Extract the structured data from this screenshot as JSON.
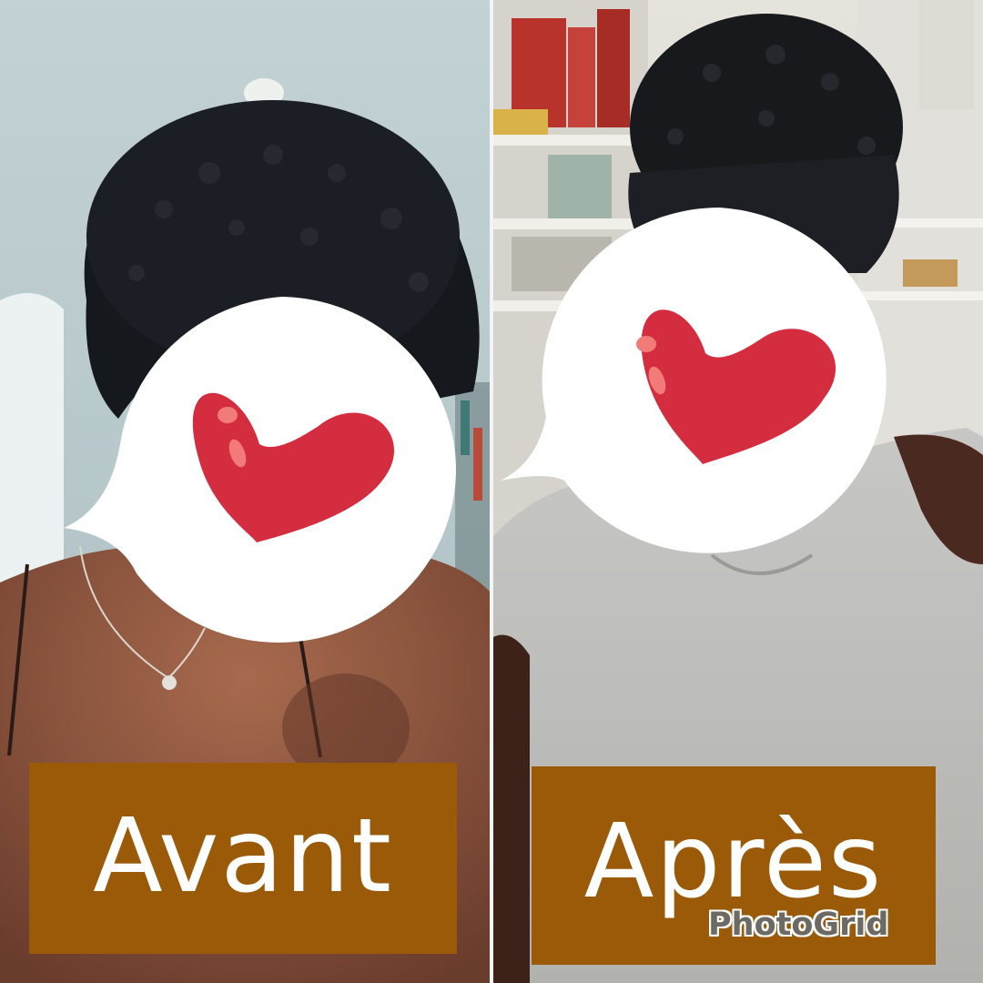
{
  "layout": "before-after-collage",
  "panels": [
    {
      "id": "left",
      "label": "Avant",
      "label_color": "#ffffff",
      "label_bg": "#9a5a08",
      "sticker": "heart-speech-bubble-icon"
    },
    {
      "id": "right",
      "label": "Après",
      "label_color": "#ffffff",
      "label_bg": "#9a5a08",
      "sticker": "heart-speech-bubble-icon"
    }
  ],
  "watermark": "PhotoGrid",
  "colors": {
    "heart": "#d42d3f",
    "heart_highlight": "#f27a78",
    "divider": "#f4f4f4"
  }
}
